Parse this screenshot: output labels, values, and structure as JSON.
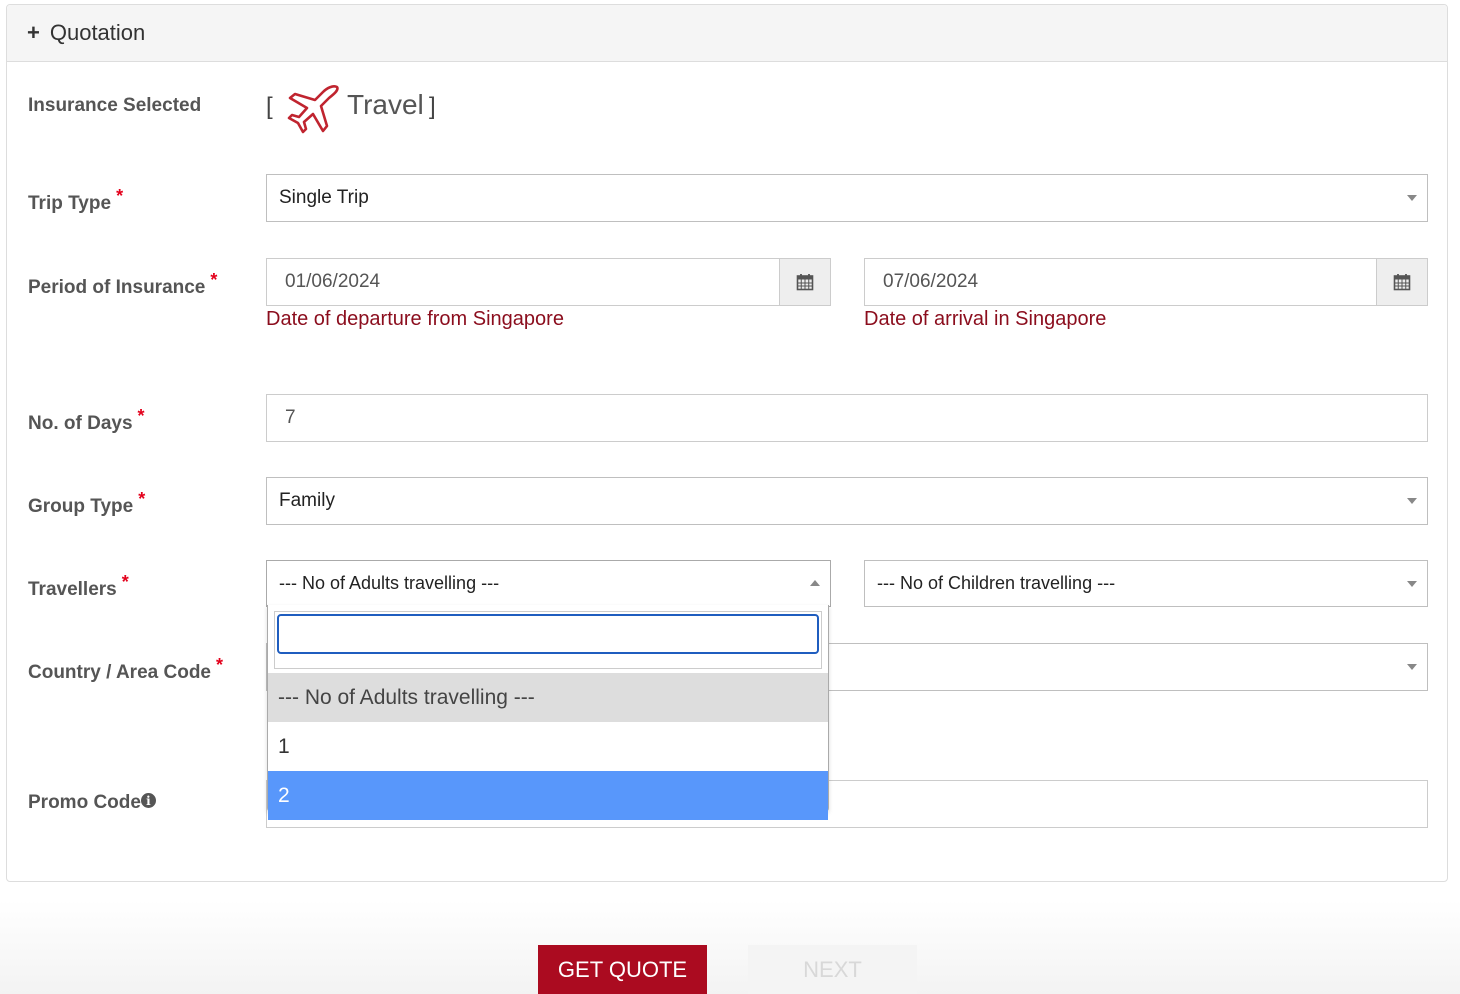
{
  "panel": {
    "title": "Quotation"
  },
  "insurance": {
    "label": "Insurance Selected",
    "bracket_open": "[",
    "bracket_close": "]",
    "product": "Travel",
    "icon": "airplane-icon",
    "icon_color": "#c0242f"
  },
  "trip_type": {
    "label": "Trip Type",
    "required": "*",
    "value": "Single Trip"
  },
  "period": {
    "label": "Period of Insurance",
    "required": "*",
    "start_value": "01/06/2024",
    "end_value": "07/06/2024",
    "start_hint": "Date of departure from Singapore",
    "end_hint": "Date of arrival in Singapore"
  },
  "days": {
    "label": "No. of Days",
    "required": "*",
    "value": "7"
  },
  "group_type": {
    "label": "Group Type",
    "required": "*",
    "value": "Family"
  },
  "travellers": {
    "label": "Travellers",
    "required": "*",
    "adults_value": "--- No of Adults travelling ---",
    "children_value": "--- No of Children travelling ---"
  },
  "adults_dropdown": {
    "search_value": "",
    "options": [
      "--- No of Adults travelling ---",
      "1",
      "2"
    ]
  },
  "country": {
    "label": "Country / Area Code",
    "required": "*"
  },
  "promo": {
    "label": "Promo Code",
    "info_icon": "info-icon"
  },
  "buttons": {
    "get_quote": "GET QUOTE",
    "next": "NEXT"
  },
  "colors": {
    "required": "#e3001b",
    "hint": "#8b0d1d",
    "primary_button": "#ab0b20",
    "highlight": "#5897fb"
  }
}
